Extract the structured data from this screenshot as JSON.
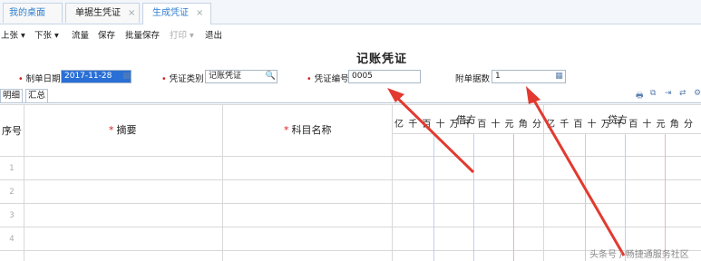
{
  "tabs": [
    {
      "label": "我的桌面"
    },
    {
      "label": "单据生凭证",
      "close": "×"
    },
    {
      "label": "生成凭证",
      "close": "×"
    }
  ],
  "toolbar": {
    "prev_label": "上张 ▾",
    "next_label": "下张 ▾",
    "flow_label": "流量",
    "save_label": "保存",
    "batch_save_label": "批量保存",
    "print_label": "打印 ▾",
    "exit_label": "退出"
  },
  "voucher": {
    "title": "记账凭证",
    "date_label": "制单日期",
    "date_value": "2017-11-28",
    "type_label": "凭证类别",
    "type_value": "记账凭证",
    "number_label": "凭证编号",
    "number_value": "0005",
    "attach_label": "附单据数",
    "attach_value": "1"
  },
  "subtabs": [
    {
      "label": "明细"
    },
    {
      "label": "汇总"
    }
  ],
  "table": {
    "col_seq": "序号",
    "col_summary": "摘要",
    "col_account": "科目名称",
    "debit": "借方",
    "credit": "贷方",
    "digits": [
      "亿",
      "千",
      "百",
      "十",
      "万",
      "千",
      "百",
      "十",
      "元",
      "角",
      "分"
    ],
    "rows": [
      "1",
      "2",
      "3",
      "4"
    ]
  },
  "watermark": "头条号 / 畅捷通服务社区",
  "colors": {
    "accent": "#2f7fd0",
    "required": "#d62020",
    "arrow": "#e23a30"
  }
}
